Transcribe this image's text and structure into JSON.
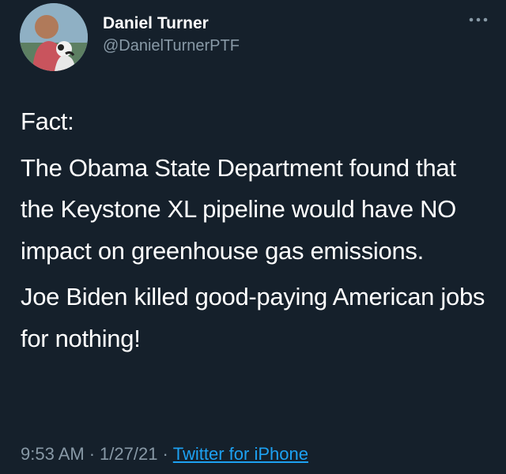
{
  "author": {
    "name": "Daniel Turner",
    "handle": "@DanielTurnerPTF"
  },
  "icons": {
    "more": "more-horizontal-icon"
  },
  "tweet": {
    "paragraphs": [
      "Fact:",
      "The Obama State Department found that the Keystone XL pipeline would have NO impact on greenhouse gas emissions.",
      "Joe Biden killed good-paying American jobs for nothing!"
    ],
    "time": "9:53 AM",
    "date": "1/27/21",
    "separator": "·",
    "source": "Twitter for iPhone"
  },
  "colors": {
    "background": "#15202b",
    "text": "#ffffff",
    "secondary_text": "#8899a6",
    "link": "#1da1f2"
  }
}
